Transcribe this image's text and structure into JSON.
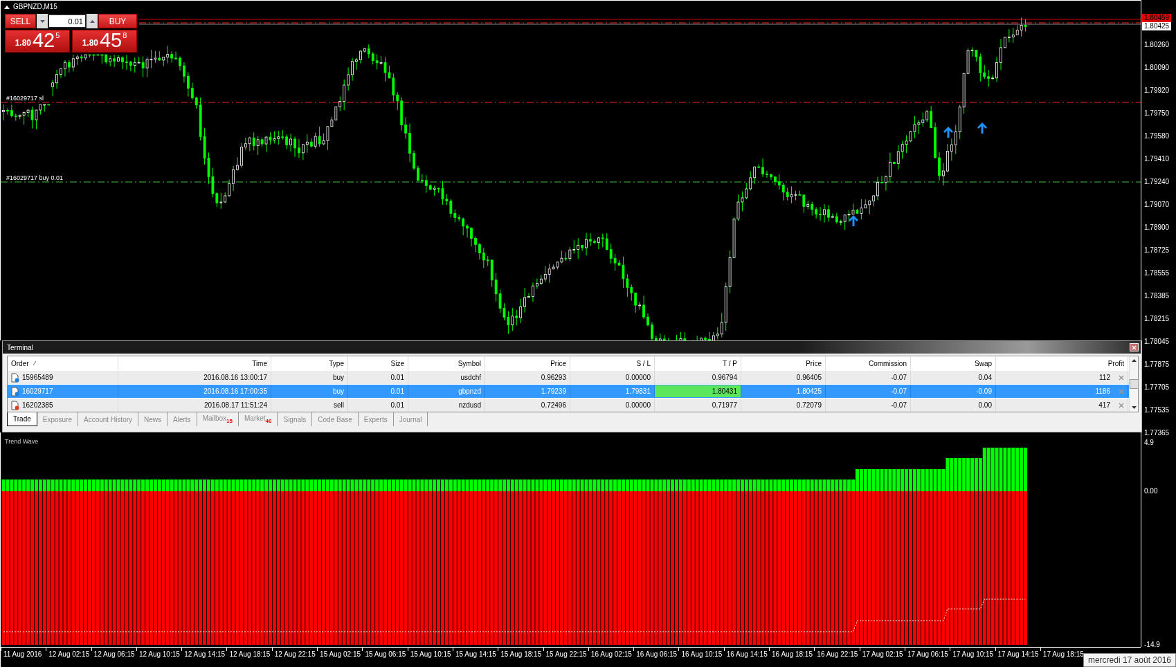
{
  "chart": {
    "symbol": "GBPNZD,M15",
    "trade_panel": {
      "sell_label": "SELL",
      "buy_label": "BUY",
      "lot": "0.01",
      "sell_price": {
        "prefix": "1.80",
        "pips": "42",
        "fraction": "5"
      },
      "buy_price": {
        "prefix": "1.80",
        "pips": "45",
        "fraction": "8"
      }
    },
    "order_lines": [
      {
        "kind": "stop_loss",
        "label": "#16029717 sl"
      },
      {
        "kind": "entry",
        "label": "#16029717 buy 0.01"
      }
    ],
    "price_tags": [
      {
        "kind": "ask",
        "value": "1.80459"
      },
      {
        "kind": "bid",
        "value": "1.80425"
      }
    ],
    "price_axis": [
      "1.80260",
      "1.80090",
      "1.79920",
      "1.79750",
      "1.79580",
      "1.79410",
      "1.79240",
      "1.79070",
      "1.78900",
      "1.78725",
      "1.78555",
      "1.78385",
      "1.78215",
      "1.78045",
      "1.77875",
      "1.77705",
      "1.77535",
      "1.77365"
    ]
  },
  "terminal": {
    "title": "Terminal",
    "columns": [
      "Order",
      "Time",
      "Type",
      "Size",
      "Symbol",
      "Price",
      "S / L",
      "T / P",
      "Price",
      "Commission",
      "Swap",
      "Profit"
    ],
    "rows": [
      {
        "kind": "buy",
        "selected": false,
        "tp_highlighted": false,
        "cells": [
          "15965489",
          "2016.08.16 13:00:17",
          "buy",
          "0.01",
          "usdchf",
          "0.96293",
          "0.00000",
          "0.96794",
          "0.96405",
          "-0.07",
          "0.04",
          "112"
        ]
      },
      {
        "kind": "buy",
        "selected": true,
        "tp_highlighted": true,
        "cells": [
          "16029717",
          "2016.08.16 17:00:35",
          "buy",
          "0.01",
          "gbpnzd",
          "1.79239",
          "1.79831",
          "1.80431",
          "1.80425",
          "-0.07",
          "-0.09",
          "1186"
        ]
      },
      {
        "kind": "sell",
        "selected": false,
        "tp_highlighted": false,
        "cells": [
          "16202385",
          "2016.08.17 11:51:24",
          "sell",
          "0.01",
          "nzdusd",
          "0.72496",
          "0.00000",
          "0.71977",
          "0.72079",
          "-0.07",
          "0.00",
          "417"
        ]
      }
    ],
    "tabs": [
      {
        "label": "Trade",
        "selected": true
      },
      {
        "label": "Exposure",
        "selected": false
      },
      {
        "label": "Account History",
        "selected": false
      },
      {
        "label": "News",
        "selected": false
      },
      {
        "label": "Alerts",
        "selected": false
      },
      {
        "label": "Mailbox",
        "badge": "15",
        "selected": false
      },
      {
        "label": "Market",
        "badge": "46",
        "selected": false
      },
      {
        "label": "Signals",
        "selected": false
      },
      {
        "label": "Code Base",
        "selected": false
      },
      {
        "label": "Experts",
        "selected": false
      },
      {
        "label": "Journal",
        "selected": false
      }
    ]
  },
  "indicator": {
    "name": "Trend Wave",
    "axis": [
      "4.9",
      "0.00",
      "-14.9"
    ]
  },
  "time_axis": {
    "labels": [
      "11 Aug 2016",
      "12 Aug 02:15",
      "12 Aug 06:15",
      "12 Aug 10:15",
      "12 Aug 14:15",
      "12 Aug 18:15",
      "12 Aug 22:15",
      "15 Aug 02:15",
      "15 Aug 06:15",
      "15 Aug 10:15",
      "15 Aug 14:15",
      "15 Aug 18:15",
      "15 Aug 22:15",
      "16 Aug 02:15",
      "16 Aug 06:15",
      "16 Aug 10:15",
      "16 Aug 14:15",
      "16 Aug 18:15",
      "16 Aug 22:15",
      "17 Aug 02:15",
      "17 Aug 06:15",
      "17 Aug 10:15",
      "17 Aug 14:15",
      "17 Aug 18:15"
    ],
    "tooltip": "mercredi 17 août 2016"
  }
}
